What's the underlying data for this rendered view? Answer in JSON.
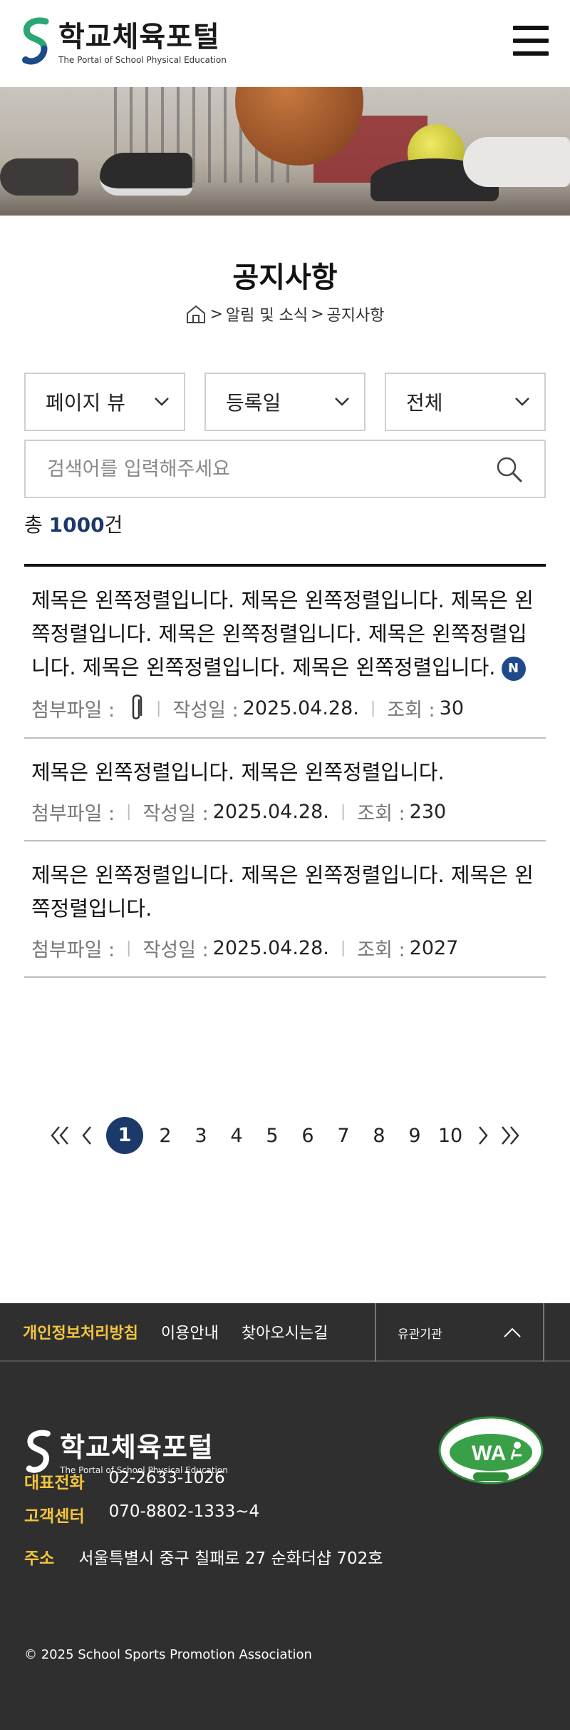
{
  "header": {
    "logo_title": "학교체육포털",
    "logo_sub": "The Portal of School Physical Education"
  },
  "page": {
    "title": "공지사항",
    "breadcrumb": [
      "알림 및 소식",
      "공지사항"
    ]
  },
  "filters": {
    "view": "페이지 뷰",
    "sort": "등록일",
    "category": "전체"
  },
  "search": {
    "placeholder": "검색어를 입력해주세요",
    "value": ""
  },
  "total": {
    "prefix": "총",
    "count": "1000",
    "suffix": "건"
  },
  "meta_labels": {
    "attach": "첨부파일 :",
    "date": "작성일 :",
    "views": "조회 :"
  },
  "items": [
    {
      "title": "제목은 왼쪽정렬입니다. 제목은 왼쪽정렬입니다. 제목은 왼쪽정렬입니다. 제목은 왼쪽정렬입니다. 제목은 왼쪽정렬입니다. 제목은 왼쪽정렬입니다. 제목은 왼쪽정렬입니다.",
      "badge": "N",
      "date": "2025.04.28.",
      "views": "30"
    },
    {
      "title": "제목은 왼쪽정렬입니다. 제목은 왼쪽정렬입니다.",
      "date": "2025.04.28.",
      "views": "230"
    },
    {
      "title": "제목은 왼쪽정렬입니다. 제목은 왼쪽정렬입니다. 제목은 왼쪽정렬입니다.",
      "date": "2025.04.28.",
      "views": "2027"
    }
  ],
  "pagination": {
    "pages": [
      "1",
      "2",
      "3",
      "4",
      "5",
      "6",
      "7",
      "8",
      "9",
      "10"
    ],
    "current": "1"
  },
  "footer": {
    "links": [
      "개인정보처리방침",
      "이용안내",
      "찾아오시는길"
    ],
    "related": "유관기관",
    "logo_title": "학교체육포털",
    "logo_sub": "The Portal of School Physical Education",
    "phone_label": "대표전화",
    "phone": "02-2633-1026",
    "center_label": "고객센터",
    "center": "070-8802-1333~4",
    "address_label": "주소",
    "address": "서울특별시 중구 칠패로 27 순화더샵 702호",
    "copyright": "© 2025 School Sports Promotion Association",
    "wa_mark": "과학기술정보통신부 WA WEB 접근성"
  },
  "colors": {
    "accent": "#1b3a6b",
    "footer_bg": "#2f2f2f",
    "footer_label": "#f3c43f",
    "badge": "#1f4a8a"
  }
}
